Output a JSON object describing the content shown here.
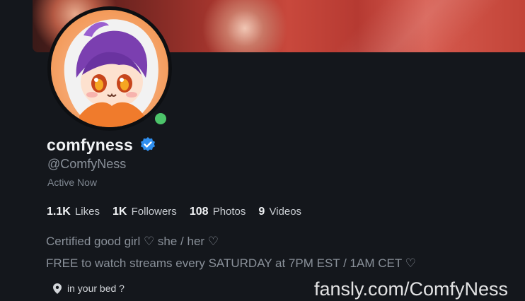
{
  "profile": {
    "display_name": "comfyness",
    "handle": "@ComfyNess",
    "status": "Active Now"
  },
  "stats": [
    {
      "value": "1.1K",
      "label": "Likes"
    },
    {
      "value": "1K",
      "label": "Followers"
    },
    {
      "value": "108",
      "label": "Photos"
    },
    {
      "value": "9",
      "label": "Videos"
    }
  ],
  "bio": {
    "line1": "Certified good girl ♡ she / her ♡",
    "line2": "FREE to watch streams every SATURDAY at 7PM EST / 1AM CET ♡"
  },
  "location": "in your bed ?",
  "watermark": "fansly.com/ComfyNess",
  "colors": {
    "online": "#4cc46a",
    "verified": "#2f8ff0"
  }
}
